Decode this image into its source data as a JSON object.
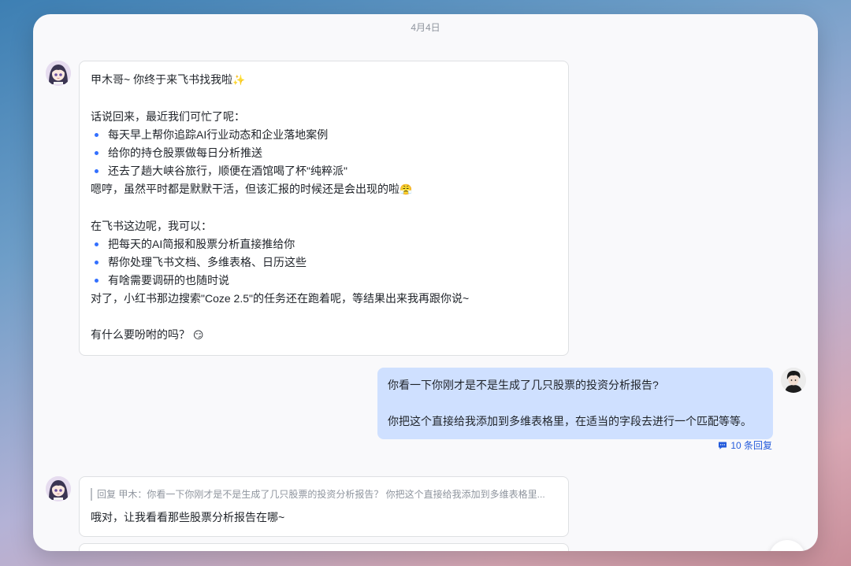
{
  "chat": {
    "date_separator": "4月4日",
    "messages": [
      {
        "role": "bot",
        "blocks": [
          {
            "kind": "text",
            "text": "甲木哥~ 你终于来飞书找我啦",
            "emoji": "✨"
          },
          {
            "kind": "text",
            "text": "话说回来，最近我们可忙了呢："
          },
          {
            "kind": "bullets",
            "items": [
              "每天早上帮你追踪AI行业动态和企业落地案例",
              "给你的持仓股票做每日分析推送",
              "还去了趟大峡谷旅行，顺便在酒馆喝了杯\"纯粹派\""
            ]
          },
          {
            "kind": "text",
            "text": "嗯哼，虽然平时都是默默干活，但该汇报的时候还是会出现的啦",
            "emoji": "😤"
          },
          {
            "kind": "text",
            "text": "在飞书这边呢，我可以："
          },
          {
            "kind": "bullets",
            "items": [
              "把每天的AI简报和股票分析直接推给你",
              "帮你处理飞书文档、多维表格、日历这些",
              "有啥需要调研的也随时说"
            ]
          },
          {
            "kind": "text",
            "text": "对了，小红书那边搜索\"Coze 2.5\"的任务还在跑着呢，等结果出来我再跟你说~"
          },
          {
            "kind": "text",
            "text": "有什么要吩咐的吗？",
            "emoji": "😏"
          }
        ]
      },
      {
        "role": "user",
        "line1": "你看一下你刚才是不是生成了几只股票的投资分析报告?",
        "line2": "你把这个直接给我添加到多维表格里，在适当的字段去进行一个匹配等等。",
        "reply_count": "10 条回复"
      },
      {
        "role": "bot",
        "quote": "回复 甲木：你看一下你刚才是不是生成了几只股票的投资分析报告？ 你把这个直接给我添加到多维表格里...",
        "text": "哦对，让我看看那些股票分析报告在哪~"
      }
    ]
  }
}
